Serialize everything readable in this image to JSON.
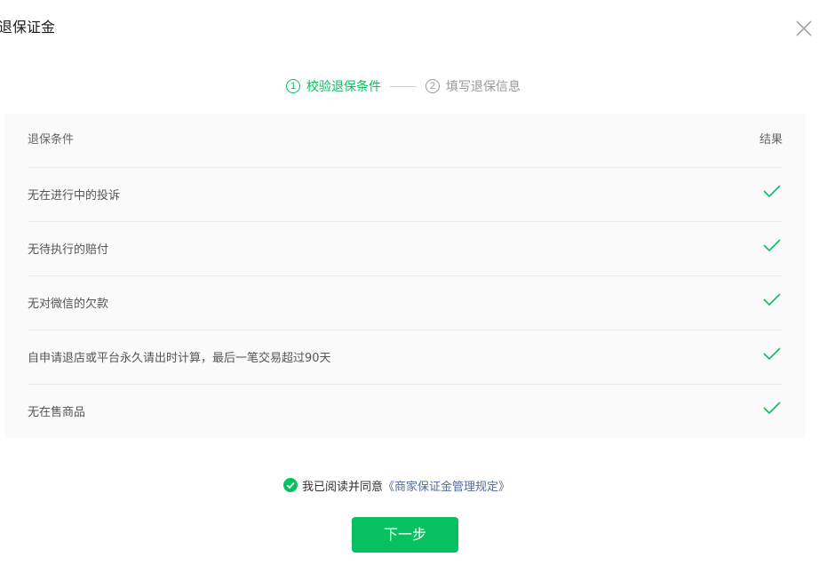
{
  "dialog": {
    "title": "退保证金",
    "close_icon": "close-icon"
  },
  "steps": [
    {
      "number": "1",
      "label": "校验退保条件",
      "state": "active"
    },
    {
      "number": "2",
      "label": "填写退保信息",
      "state": "inactive"
    }
  ],
  "table": {
    "headers": {
      "condition": "退保条件",
      "result": "结果"
    },
    "rows": [
      {
        "condition": "无在进行中的投诉",
        "result_icon": "check-icon"
      },
      {
        "condition": "无待执行的赔付",
        "result_icon": "check-icon"
      },
      {
        "condition": "无对微信的欠款",
        "result_icon": "check-icon"
      },
      {
        "condition": "自申请退店或平台永久请出时计算，最后一笔交易超过90天",
        "result_icon": "check-icon"
      },
      {
        "condition": "无在售商品",
        "result_icon": "check-icon"
      }
    ]
  },
  "agreement": {
    "checked": true,
    "text": "我已阅读并同意",
    "link_text": "《商家保证金管理规定》"
  },
  "actions": {
    "next_label": "下一步"
  },
  "colors": {
    "accent": "#07c160",
    "link": "#576b95",
    "step_inactive": "#9a9a9a"
  }
}
